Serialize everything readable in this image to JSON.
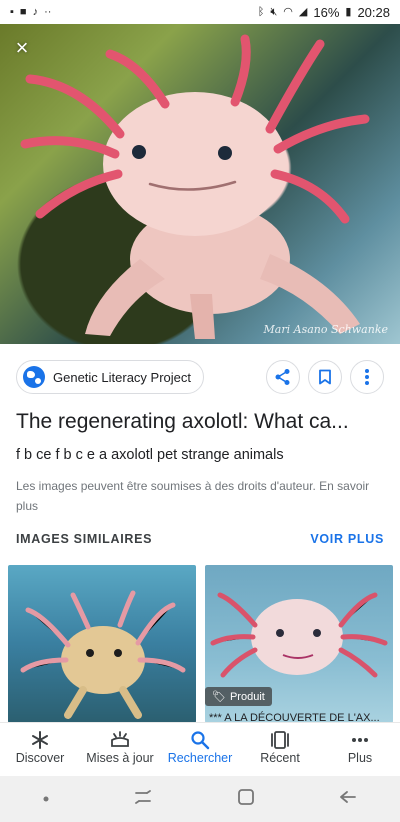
{
  "status_bar": {
    "battery": "16%",
    "time": "20:28",
    "icons_left": [
      "photo-icon",
      "message-icon",
      "tiktok-icon",
      "more-dots-icon"
    ],
    "icons_right": [
      "bluetooth-icon",
      "mute-icon",
      "wifi-icon",
      "signal-icon",
      "battery-icon"
    ]
  },
  "hero": {
    "close_icon": "×",
    "watermark": "Mari Asano Schwanke"
  },
  "source": {
    "name": "Genetic Literacy Project",
    "actions": [
      "share-icon",
      "bookmark-icon",
      "more-vert-icon"
    ]
  },
  "result": {
    "title": "The regenerating axolotl: What ca...",
    "subtitle": "f b ce f b c e a axolotl pet strange animals",
    "copyright": "Les images peuvent être soumises à des droits d'auteur. En savoir plus"
  },
  "similar": {
    "header": "IMAGES SIMILAIRES",
    "see_more": "VOIR PLUS",
    "items": [
      {
        "badge": "",
        "caption": ""
      },
      {
        "badge": "Produit",
        "caption": "*** A LA DÉCOUVERTE DE L'AX..."
      }
    ]
  },
  "bottom_nav": [
    {
      "label": "Discover",
      "icon": "asterisk-icon",
      "active": false
    },
    {
      "label": "Mises à jour",
      "icon": "updates-icon",
      "active": false
    },
    {
      "label": "Rechercher",
      "icon": "search-icon",
      "active": true
    },
    {
      "label": "Récent",
      "icon": "recent-icon",
      "active": false
    },
    {
      "label": "Plus",
      "icon": "more-dots-icon",
      "active": false
    }
  ],
  "colors": {
    "accent": "#1a73e8",
    "text": "#202124",
    "muted": "#70757a"
  }
}
